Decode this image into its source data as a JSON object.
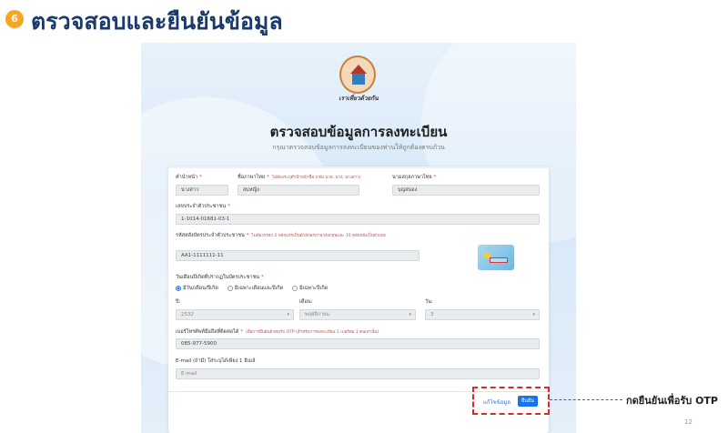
{
  "slide": {
    "step_number": "6",
    "title": "ตรวจสอบและยืนยันข้อมูล",
    "callout": "กดยืนยันเพื่อรับ OTP",
    "page_number": "12"
  },
  "screen": {
    "logo_text": "เราเที่ยวด้วยกัน",
    "form_title": "ตรวจสอบข้อมูลการลงทะเบียน",
    "form_subtitle": "กรุณาตรวจสอบข้อมูลการลงทะเบียนของท่านให้ถูกต้องครบถ้วน"
  },
  "form": {
    "title_prefix_label": "คำนำหน้า",
    "title_prefix_value": "นางสาว",
    "first_name_label": "ชื่อภาษาไทย",
    "first_name_hint": "ไม่ต้องระบุคำนำหน้าชื่อ (เช่น นาย, นาง, นางสาว)",
    "first_name_value": "สมหญิง",
    "last_name_label": "นามสกุลภาษาไทย",
    "last_name_value": "บุญสนอง",
    "id_label": "เลขประจำตัวประชาชน",
    "id_value": "1-1014-01681-03-1",
    "laser_label": "รหัสหลังบัตรประจำตัวประชาชน",
    "laser_hint": "ไม่ต้องกรอก 2 หลักแรกเป็นตัวอักษรภาษาอังกฤษและ 10 หลักหลังเป็นตัวเลข",
    "laser_value": "AA1-1111111-11",
    "dob_label": "วันเดือนปีเกิดที่ปรากฏในบัตรประชาชน",
    "dob_options": [
      "มีวัน/เดือน/ปีเกิด",
      "มีเฉพาะเดือนและปีเกิด",
      "มีเฉพาะปีเกิด"
    ],
    "year_label": "ปี:",
    "year_value": "2532",
    "month_label": "เดือน:",
    "month_value": "พฤศจิกายน",
    "day_label": "วัน:",
    "day_value": "3",
    "phone_label": "เบอร์โทรศัพท์มือถือที่ติดต่อได้",
    "phone_hint": "เพื่อการยืนยันตัวตนรับ OTP (สำหรับการลงทะเบียน 1 เบอร์ต่อ 1 คนเท่านั้น)",
    "phone_value": "085-977-5900",
    "email_label": "E-mail (ถ้ามี) ใส่ระบุได้เพียง 1 อีเมล์",
    "email_placeholder": "E-mail",
    "edit_button": "แก้ไขข้อมูล",
    "confirm_button": "ยืนยัน"
  }
}
